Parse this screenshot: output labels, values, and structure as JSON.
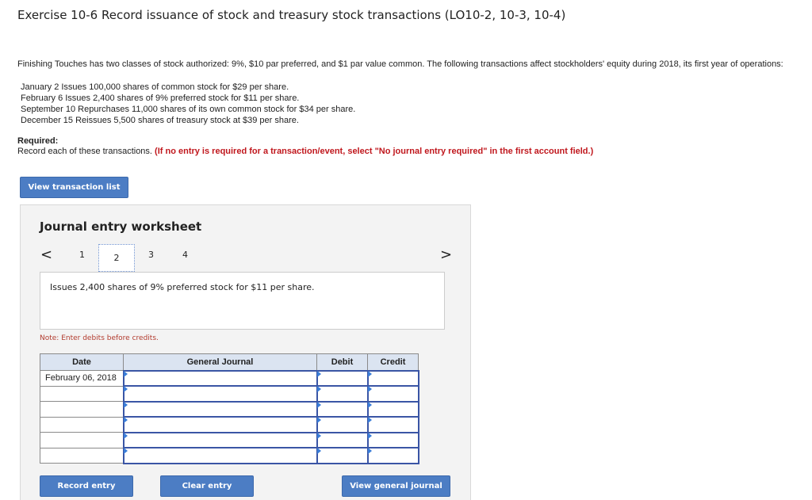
{
  "title": "Exercise 10-6 Record issuance of stock and treasury stock transactions (LO10-2, 10-3, 10-4)",
  "intro": "Finishing Touches has two classes of stock authorized: 9%, $10 par preferred, and $1 par value common. The following transactions affect stockholders' equity during 2018, its first year of operations:",
  "transactions": [
    "January 2 Issues 100,000 shares of common stock for $29 per share.",
    "February 6 Issues 2,400 shares of 9% preferred stock for $11 per share.",
    "September 10 Repurchases 11,000 shares of its own common stock for $34 per share.",
    "December 15 Reissues 5,500 shares of treasury stock at $39 per share."
  ],
  "required": {
    "heading": "Required:",
    "text": "Record each of these transactions.",
    "instruction": "(If no entry is required for a transaction/event, select \"No journal entry required\" in the first account field.)"
  },
  "buttons": {
    "view_transaction_list": "View transaction list",
    "record_entry": "Record entry",
    "clear_entry": "Clear entry",
    "view_general_journal": "View general journal"
  },
  "worksheet": {
    "title": "Journal entry worksheet",
    "prev": "<",
    "next": ">",
    "pages": [
      "1",
      "2",
      "3",
      "4"
    ],
    "active_page": "2",
    "description": "Issues 2,400 shares of 9% preferred stock for $11 per share.",
    "note": "Note: Enter debits before credits."
  },
  "journal": {
    "headers": {
      "date": "Date",
      "account": "General Journal",
      "debit": "Debit",
      "credit": "Credit"
    },
    "rows": [
      {
        "date": "February 06, 2018",
        "account": "",
        "debit": "",
        "credit": ""
      },
      {
        "date": "",
        "account": "",
        "debit": "",
        "credit": ""
      },
      {
        "date": "",
        "account": "",
        "debit": "",
        "credit": ""
      },
      {
        "date": "",
        "account": "",
        "debit": "",
        "credit": ""
      },
      {
        "date": "",
        "account": "",
        "debit": "",
        "credit": ""
      },
      {
        "date": "",
        "account": "",
        "debit": "",
        "credit": ""
      }
    ]
  },
  "colors": {
    "button_blue": "#4c7dc4",
    "header_fill": "#dbe4f1",
    "input_border": "#3a55a5",
    "red_text": "#c0171d"
  }
}
